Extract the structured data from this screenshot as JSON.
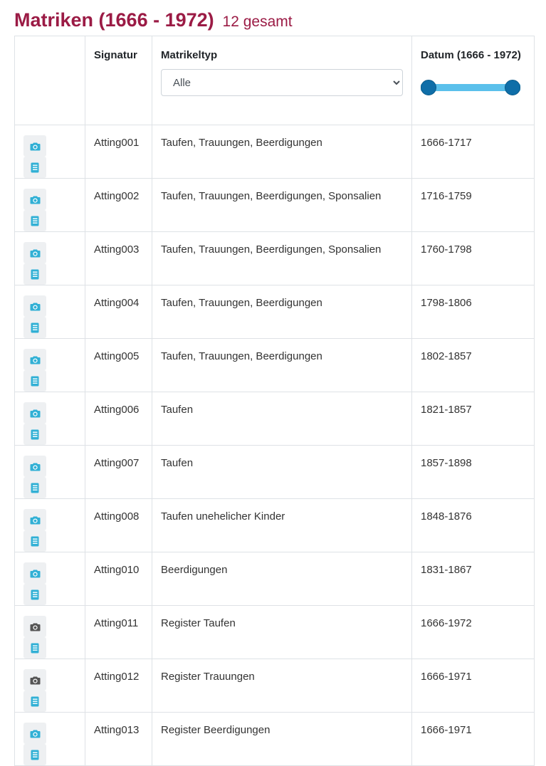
{
  "header": {
    "title": "Matriken (1666 - 1972)",
    "count": "12 gesamt"
  },
  "columns": {
    "signatur": "Signatur",
    "matrikeltyp": "Matrikeltyp",
    "datum": "Datum (1666 - 1972)"
  },
  "filter": {
    "matrikeltyp_selected": "Alle"
  },
  "date_slider": {
    "min": 1666,
    "max": 1972,
    "selected_min": 1666,
    "selected_max": 1972
  },
  "colors": {
    "accent": "#9b1b45",
    "icon_active": "#31b0d5",
    "icon_inactive": "#555555"
  },
  "rows": [
    {
      "signatur": "Atting001",
      "typ": "Taufen, Trauungen, Beerdigungen",
      "datum": "1666-1717",
      "camera": "active"
    },
    {
      "signatur": "Atting002",
      "typ": "Taufen, Trauungen, Beerdigungen, Sponsalien",
      "datum": "1716-1759",
      "camera": "active"
    },
    {
      "signatur": "Atting003",
      "typ": "Taufen, Trauungen, Beerdigungen, Sponsalien",
      "datum": "1760-1798",
      "camera": "active"
    },
    {
      "signatur": "Atting004",
      "typ": "Taufen, Trauungen, Beerdigungen",
      "datum": "1798-1806",
      "camera": "active"
    },
    {
      "signatur": "Atting005",
      "typ": "Taufen, Trauungen, Beerdigungen",
      "datum": "1802-1857",
      "camera": "active"
    },
    {
      "signatur": "Atting006",
      "typ": "Taufen",
      "datum": "1821-1857",
      "camera": "active"
    },
    {
      "signatur": "Atting007",
      "typ": "Taufen",
      "datum": "1857-1898",
      "camera": "active"
    },
    {
      "signatur": "Atting008",
      "typ": "Taufen unehelicher Kinder",
      "datum": "1848-1876",
      "camera": "active"
    },
    {
      "signatur": "Atting010",
      "typ": "Beerdigungen",
      "datum": "1831-1867",
      "camera": "active"
    },
    {
      "signatur": "Atting011",
      "typ": "Register Taufen",
      "datum": "1666-1972",
      "camera": "inactive"
    },
    {
      "signatur": "Atting012",
      "typ": "Register Trauungen",
      "datum": "1666-1971",
      "camera": "inactive"
    },
    {
      "signatur": "Atting013",
      "typ": "Register Beerdigungen",
      "datum": "1666-1971",
      "camera": "active"
    }
  ]
}
